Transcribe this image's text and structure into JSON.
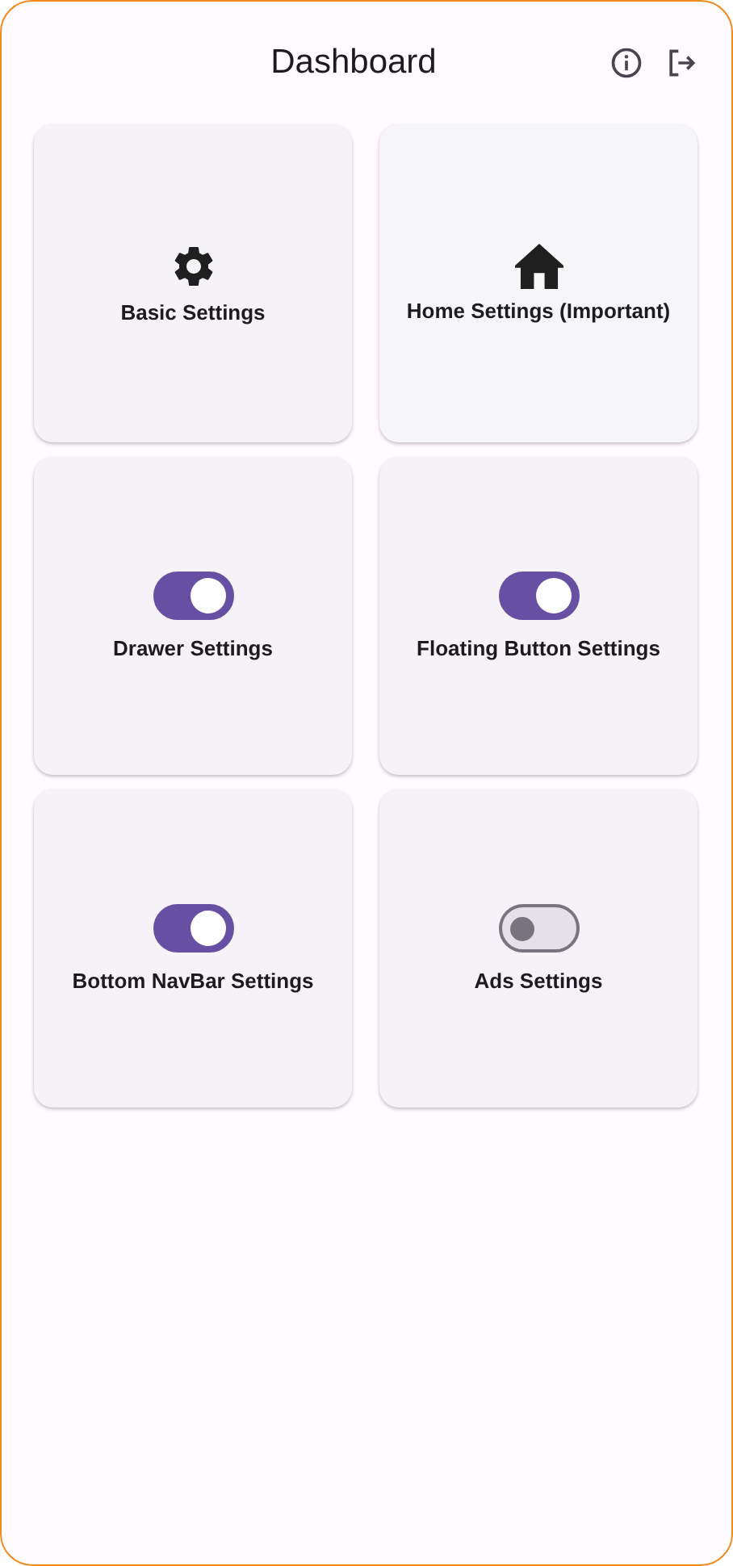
{
  "app_bar": {
    "title": "Dashboard",
    "actions": [
      {
        "kind": "info"
      },
      {
        "kind": "logout"
      }
    ]
  },
  "cards": [
    {
      "kind": "gear",
      "label": "Basic Settings"
    },
    {
      "kind": "house",
      "label": "Home Settings (Important)"
    },
    {
      "kind": "switch",
      "on": true,
      "label": "Drawer Settings"
    },
    {
      "kind": "switch",
      "on": true,
      "label": "Floating Button Settings"
    },
    {
      "kind": "switch",
      "on": true,
      "label": "Bottom NavBar Settings"
    },
    {
      "kind": "switch",
      "on": false,
      "label": "Ads Settings"
    }
  ]
}
